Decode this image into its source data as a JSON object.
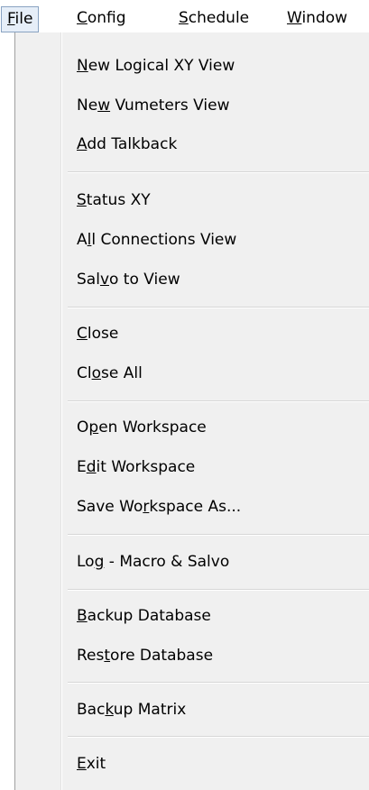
{
  "menubar": [
    {
      "pre": "",
      "k": "F",
      "post": "ile"
    },
    {
      "pre": "",
      "k": "C",
      "post": "onfig"
    },
    {
      "pre": "",
      "k": "S",
      "post": "chedule"
    },
    {
      "pre": "",
      "k": "W",
      "post": "indow"
    }
  ],
  "menu": [
    {
      "pre": "",
      "k": "N",
      "post": "ew Logical XY View"
    },
    {
      "pre": "Ne",
      "k": "w",
      "post": " Vumeters View"
    },
    {
      "pre": "",
      "k": "A",
      "post": "dd Talkback"
    },
    {
      "pre": "",
      "k": "S",
      "post": "tatus XY"
    },
    {
      "pre": "A",
      "k": "l",
      "post": "l Connections View"
    },
    {
      "pre": "Sal",
      "k": "v",
      "post": "o to View"
    },
    {
      "pre": "",
      "k": "C",
      "post": "lose"
    },
    {
      "pre": "Cl",
      "k": "o",
      "post": "se All"
    },
    {
      "pre": "O",
      "k": "p",
      "post": "en Workspace"
    },
    {
      "pre": "E",
      "k": "d",
      "post": "it Workspace"
    },
    {
      "pre": "Save Wo",
      "k": "r",
      "post": "kspace As..."
    },
    {
      "pre": "Lo",
      "k": "g",
      "post": " - Macro & Salvo"
    },
    {
      "pre": "",
      "k": "B",
      "post": "ackup Database"
    },
    {
      "pre": "Res",
      "k": "t",
      "post": "ore Database"
    },
    {
      "pre": "Bac",
      "k": "k",
      "post": "up Matrix"
    },
    {
      "pre": "",
      "k": "E",
      "post": "xit"
    }
  ]
}
